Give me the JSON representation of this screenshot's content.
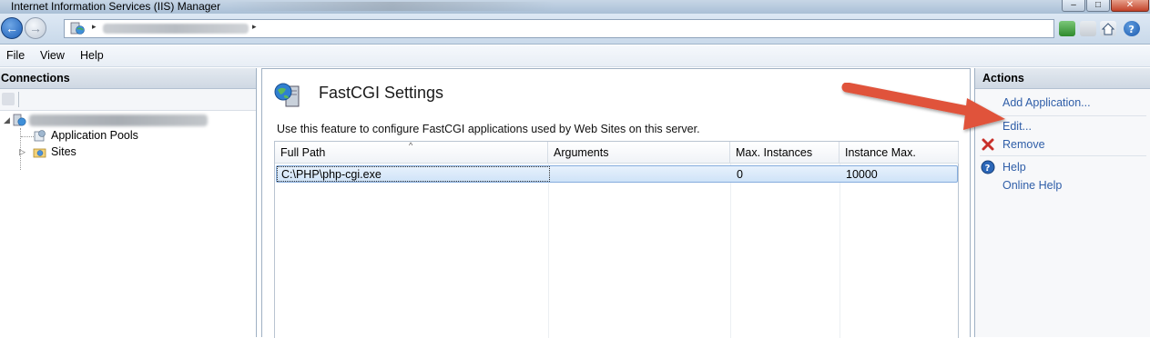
{
  "window": {
    "title": "Internet Information Services (IIS) Manager",
    "controls": {
      "minimize": "–",
      "maximize": "□",
      "close": "✕"
    }
  },
  "addressbar": {
    "back_icon": "back-arrow-icon",
    "forward_icon": "forward-arrow-icon",
    "separator": "▸",
    "toolbar_icons": [
      "refresh-icon",
      "stop-icon",
      "home-icon",
      "help-icon"
    ]
  },
  "menu": {
    "items": [
      "File",
      "View",
      "Help"
    ]
  },
  "connections": {
    "header": "Connections",
    "tree": {
      "root_label_blurred": true,
      "children": [
        "Application Pools",
        "Sites"
      ]
    }
  },
  "main": {
    "title": "FastCGI Settings",
    "description": "Use this feature to configure FastCGI applications used by Web Sites on this server.",
    "columns": [
      "Full Path",
      "Arguments",
      "Max. Instances",
      "Instance Max. Requests"
    ],
    "rows": [
      {
        "full_path": "C:\\PHP\\php-cgi.exe",
        "arguments": "",
        "max_instances": "0",
        "instance_max_requests": "10000"
      }
    ]
  },
  "actions": {
    "header": "Actions",
    "items": [
      "Add Application...",
      "Edit...",
      "Remove",
      "Help",
      "Online Help"
    ]
  },
  "colors": {
    "link": "#2f5ea8",
    "link_disabled": "#8aa3c6",
    "annotation_arrow": "#e0533a",
    "remove_icon": "#c8302a"
  }
}
